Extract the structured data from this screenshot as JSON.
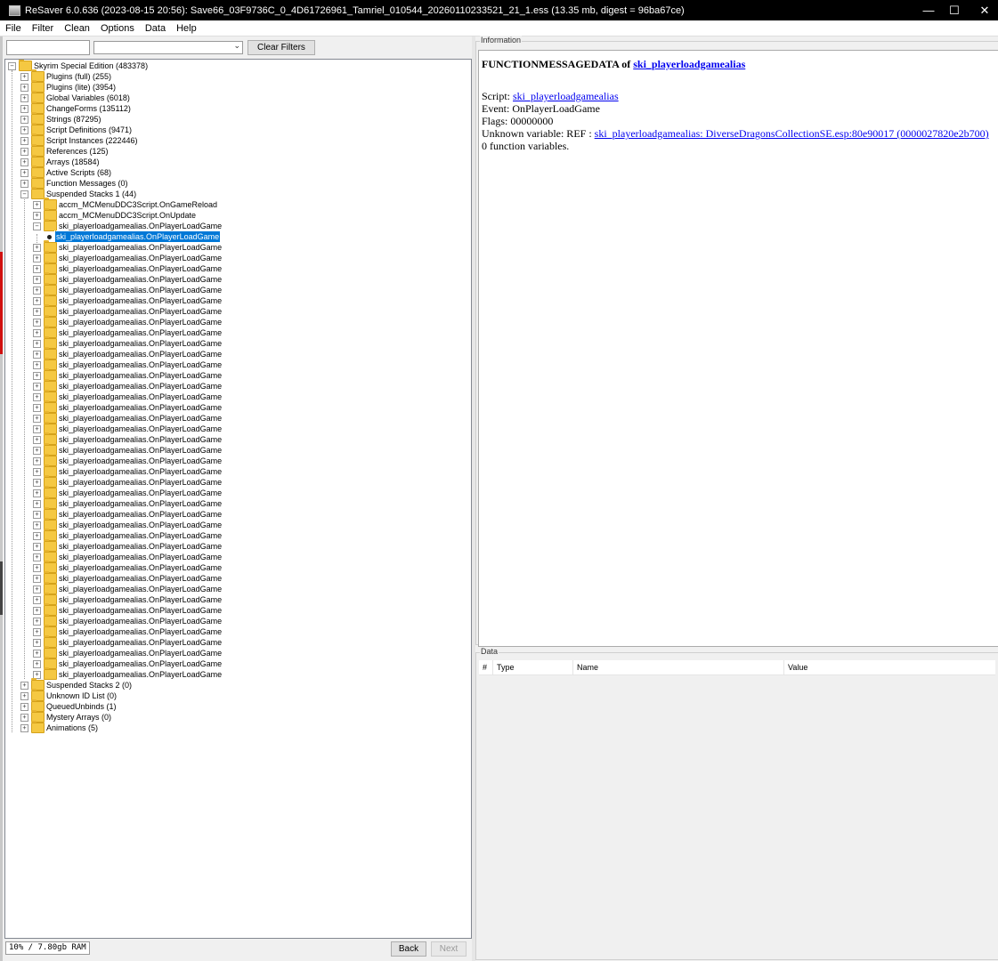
{
  "window": {
    "title": "ReSaver 6.0.636 (2023-08-15 20:56): Save66_03F9736C_0_4D61726961_Tamriel_010544_20260110233521_21_1.ess (13.35 mb, digest = 96ba67ce)",
    "controls": {
      "minimize": "—",
      "maximize": "☐",
      "close": "✕"
    }
  },
  "menu": [
    "File",
    "Filter",
    "Clean",
    "Options",
    "Data",
    "Help"
  ],
  "filter": {
    "clear_label": "Clear Filters",
    "search_value": "",
    "select_value": ""
  },
  "tree": {
    "root": "Skyrim Special Edition (483378)",
    "sections_top": [
      "Plugins (full) (255)",
      "Plugins (lite) (3954)",
      "Global Variables (6018)",
      "ChangeForms (135112)",
      "Strings (87295)",
      "Script Definitions (9471)",
      "Script Instances (222446)",
      "References (125)",
      "Arrays (18584)",
      "Active Scripts (68)",
      "Function Messages (0)"
    ],
    "expanded_section": "Suspended Stacks 1 (44)",
    "stack_children": [
      "accm_MCMenuDDC3Script.OnGameReload",
      "accm_MCMenuDDC3Script.OnUpdate",
      "ski_playerloadgamealias.OnPlayerLoadGame"
    ],
    "selected_leaf": "ski_playerloadgamealias.OnPlayerLoadGame",
    "repeated_stack": [
      "ski_playerloadgamealias.OnPlayerLoadGame",
      "ski_playerloadgamealias.OnPlayerLoadGame",
      "ski_playerloadgamealias.OnPlayerLoadGame",
      "ski_playerloadgamealias.OnPlayerLoadGame",
      "ski_playerloadgamealias.OnPlayerLoadGame",
      "ski_playerloadgamealias.OnPlayerLoadGame",
      "ski_playerloadgamealias.OnPlayerLoadGame",
      "ski_playerloadgamealias.OnPlayerLoadGame",
      "ski_playerloadgamealias.OnPlayerLoadGame",
      "ski_playerloadgamealias.OnPlayerLoadGame",
      "ski_playerloadgamealias.OnPlayerLoadGame",
      "ski_playerloadgamealias.OnPlayerLoadGame",
      "ski_playerloadgamealias.OnPlayerLoadGame",
      "ski_playerloadgamealias.OnPlayerLoadGame",
      "ski_playerloadgamealias.OnPlayerLoadGame",
      "ski_playerloadgamealias.OnPlayerLoadGame",
      "ski_playerloadgamealias.OnPlayerLoadGame",
      "ski_playerloadgamealias.OnPlayerLoadGame",
      "ski_playerloadgamealias.OnPlayerLoadGame",
      "ski_playerloadgamealias.OnPlayerLoadGame",
      "ski_playerloadgamealias.OnPlayerLoadGame",
      "ski_playerloadgamealias.OnPlayerLoadGame",
      "ski_playerloadgamealias.OnPlayerLoadGame",
      "ski_playerloadgamealias.OnPlayerLoadGame",
      "ski_playerloadgamealias.OnPlayerLoadGame",
      "ski_playerloadgamealias.OnPlayerLoadGame",
      "ski_playerloadgamealias.OnPlayerLoadGame",
      "ski_playerloadgamealias.OnPlayerLoadGame",
      "ski_playerloadgamealias.OnPlayerLoadGame",
      "ski_playerloadgamealias.OnPlayerLoadGame",
      "ski_playerloadgamealias.OnPlayerLoadGame",
      "ski_playerloadgamealias.OnPlayerLoadGame",
      "ski_playerloadgamealias.OnPlayerLoadGame",
      "ski_playerloadgamealias.OnPlayerLoadGame",
      "ski_playerloadgamealias.OnPlayerLoadGame",
      "ski_playerloadgamealias.OnPlayerLoadGame",
      "ski_playerloadgamealias.OnPlayerLoadGame",
      "ski_playerloadgamealias.OnPlayerLoadGame",
      "ski_playerloadgamealias.OnPlayerLoadGame",
      "ski_playerloadgamealias.OnPlayerLoadGame",
      "ski_playerloadgamealias.OnPlayerLoadGame"
    ],
    "sections_bottom": [
      "Suspended Stacks 2 (0)",
      "Unknown ID List (0)",
      "QueuedUnbinds (1)",
      "Mystery Arrays (0)",
      "Animations (5)"
    ]
  },
  "status": {
    "ram": "10% / 7.80gb RAM",
    "back": "Back",
    "next": "Next"
  },
  "info": {
    "legend": "Information",
    "heading_prefix": "FUNCTIONMESSAGEDATA of",
    "heading_link": "ski_playerloadgamealias",
    "script_label": "Script:",
    "script_link": "ski_playerloadgamealias",
    "event": "Event: OnPlayerLoadGame",
    "flags": "Flags: 00000000",
    "unknown_label": "Unknown variable: REF :",
    "unknown_link": "ski_playerloadgamealias: DiverseDragonsCollectionSE.esp:80e90017 (0000027820e2b700)",
    "fn_vars": "0 function variables."
  },
  "data_panel": {
    "legend": "Data",
    "columns": [
      "#",
      "Type",
      "Name",
      "Value"
    ]
  }
}
